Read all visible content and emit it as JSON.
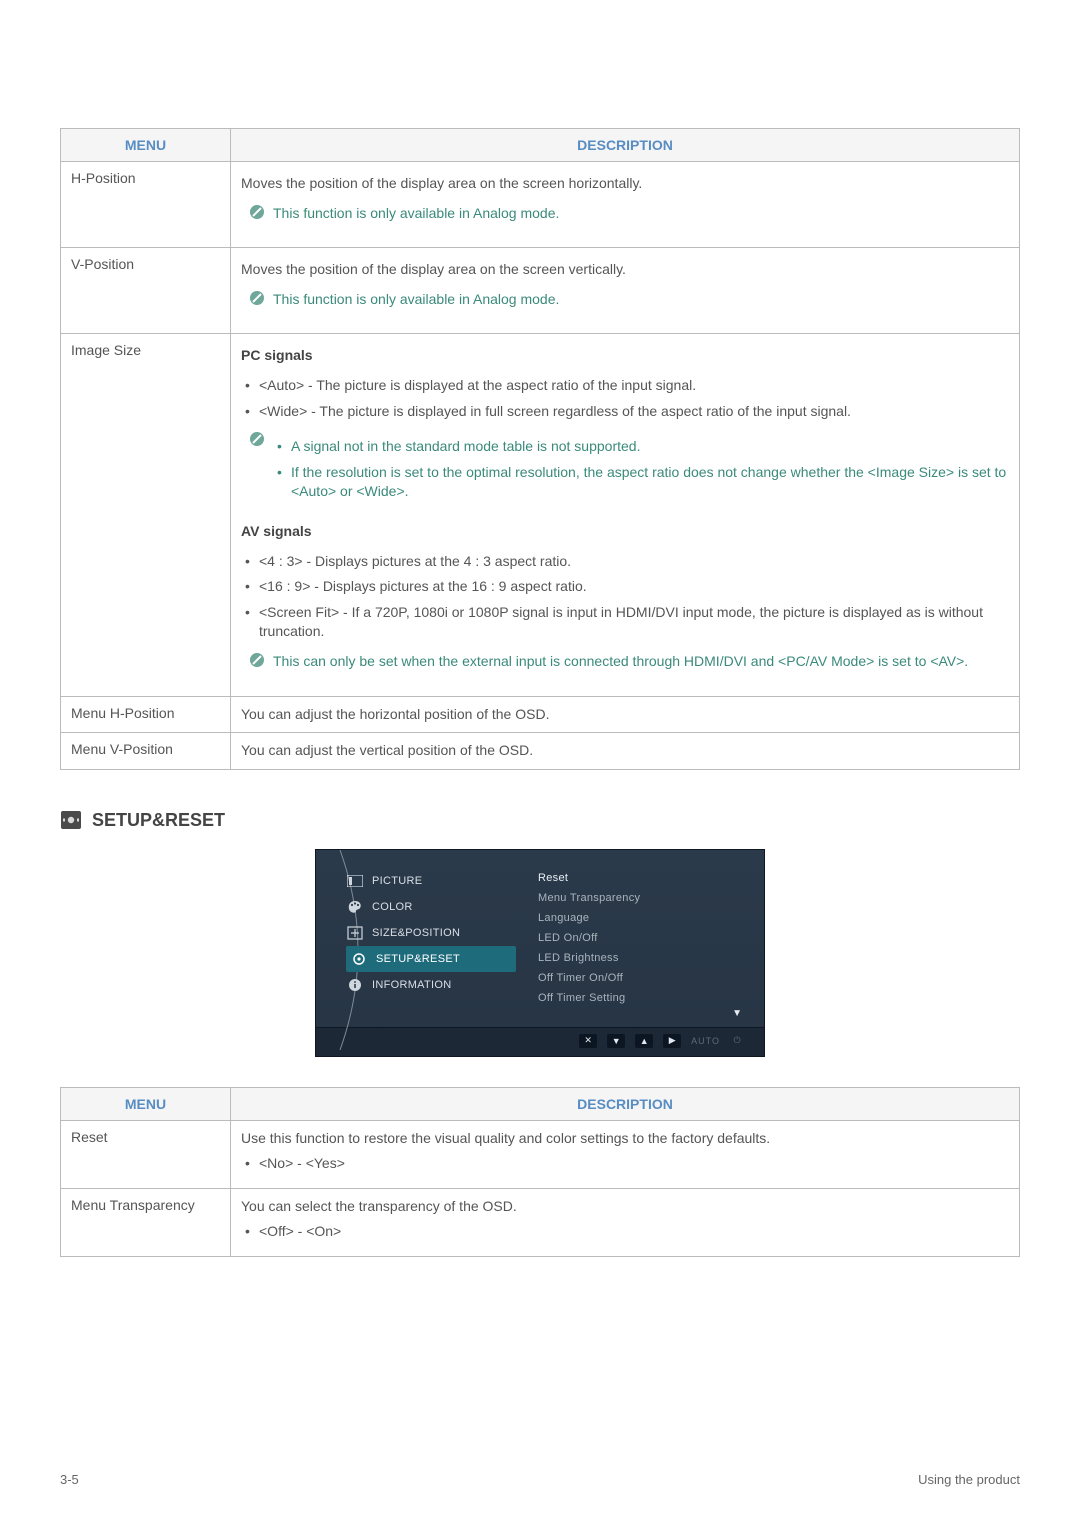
{
  "table1": {
    "headers": {
      "menu": "MENU",
      "description": "DESCRIPTION"
    },
    "rows": [
      {
        "menu": "H-Position",
        "p1": "Moves the position of the display area on the screen horizontally.",
        "note": "This function is only available in Analog mode."
      },
      {
        "menu": "V-Position",
        "p1": "Moves the position of the display area on the screen vertically.",
        "note": "This function is only available in Analog mode."
      },
      {
        "menu": "Image Size",
        "pc_heading": "PC signals",
        "pc_items": [
          "<Auto> - The picture is displayed at the aspect ratio of the input signal.",
          "<Wide> - The picture is displayed in full screen regardless of the aspect ratio of the input signal."
        ],
        "pc_note_items": [
          "A signal not in the standard mode table is not supported.",
          "If the resolution is set to the optimal resolution, the aspect ratio does not change whether the <Image Size> is set to <Auto> or <Wide>."
        ],
        "av_heading": "AV signals",
        "av_items": [
          "<4 : 3> - Displays pictures at the 4 : 3 aspect ratio.",
          "<16 : 9> - Displays pictures at the 16 : 9 aspect ratio.",
          "<Screen Fit> - If a 720P, 1080i or 1080P signal is input in HDMI/DVI input mode, the picture is displayed as is without truncation."
        ],
        "av_note": "This can only be set when the external input is connected through HDMI/DVI and <PC/AV Mode> is set to <AV>."
      },
      {
        "menu": "Menu H-Position",
        "p1": "You can adjust the horizontal position of the OSD."
      },
      {
        "menu": "Menu V-Position",
        "p1": "You can adjust the vertical position of the OSD."
      }
    ]
  },
  "section2_title": "SETUP&RESET",
  "osd": {
    "left": [
      "PICTURE",
      "COLOR",
      "SIZE&POSITION",
      "SETUP&RESET",
      "INFORMATION"
    ],
    "left_selected_index": 3,
    "right": [
      "Reset",
      "Menu Transparency",
      "Language",
      "LED On/Off",
      "LED Brightness",
      "Off Timer On/Off",
      "Off Timer Setting"
    ],
    "bottom_auto": "AUTO"
  },
  "table2": {
    "headers": {
      "menu": "MENU",
      "description": "DESCRIPTION"
    },
    "rows": [
      {
        "menu": "Reset",
        "p1": "Use this function to restore the visual quality and color settings to the factory defaults.",
        "item": "<No> - <Yes>"
      },
      {
        "menu": "Menu Transparency",
        "p1": "You can select the transparency of the OSD.",
        "item": "<Off> - <On>"
      }
    ]
  },
  "footer": {
    "left": "3-5",
    "right": "Using the product"
  }
}
